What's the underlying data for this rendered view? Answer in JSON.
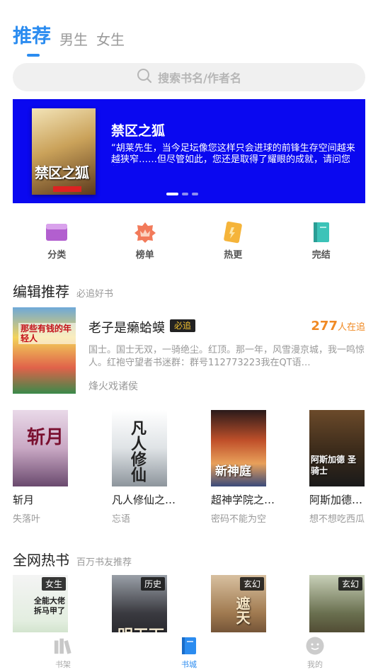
{
  "top_tabs": [
    {
      "label": "推荐",
      "active": true
    },
    {
      "label": "男生",
      "active": false
    },
    {
      "label": "女生",
      "active": false
    }
  ],
  "search": {
    "placeholder": "搜索书名/作者名",
    "icon": "search-icon"
  },
  "banner": {
    "background": "#0a08f0",
    "title": "禁区之狐",
    "description": "“胡莱先生，当今足坛像您这样只会进球的前锋生存空间越来越狭窄……但尽管如此，您还是取得了耀眼的成就，请问您的…",
    "cover_text": "禁区之狐",
    "slide_count": 3,
    "active_slide": 0
  },
  "categories": [
    {
      "label": "分类",
      "icon": "category-icon",
      "color": "#b25fcf"
    },
    {
      "label": "榜单",
      "icon": "ranking-icon",
      "color": "#f27a5a"
    },
    {
      "label": "热更",
      "icon": "hot-update-icon",
      "color": "#f5b43a"
    },
    {
      "label": "完结",
      "icon": "finished-icon",
      "color": "#3cc3b8"
    }
  ],
  "editor_section": {
    "title": "编辑推荐",
    "subtitle": "必追好书"
  },
  "featured_book": {
    "title": "老子是癞蛤蟆",
    "badge": "必追",
    "count": "277",
    "count_unit": "人在追",
    "description": "国士。国士无双，一骑绝尘。红顶。那一年，风雪漫京城，我一鸣惊人。红袍守望者书迷群：群号112773223我在QT语…",
    "author": "烽火戏诸侯",
    "cover_text": "那些有钱的年轻人"
  },
  "editor_books": [
    {
      "name": "斩月",
      "author": "失落叶",
      "cover_text": "斩月"
    },
    {
      "name": "凡人修仙之…",
      "author": "忘语",
      "cover_text": "凡人修仙"
    },
    {
      "name": "超神学院之…",
      "author": "密码不能为空",
      "cover_text": "新神庭"
    },
    {
      "name": "阿斯加德…",
      "author": "想不想吃西瓜",
      "cover_text": "阿斯加德 圣骑士"
    }
  ],
  "hot_section": {
    "title": "全网热书",
    "subtitle": "百万书友推荐"
  },
  "hot_books": [
    {
      "genre": "女生",
      "cover_text": "全能大佬 拆马甲了"
    },
    {
      "genre": "历史",
      "cover_text": "明天下"
    },
    {
      "genre": "玄幻",
      "cover_text": "遮天"
    },
    {
      "genre": "玄幻",
      "cover_text": ""
    }
  ],
  "bottom_nav": [
    {
      "label": "书架",
      "icon": "bookshelf-icon",
      "active": false
    },
    {
      "label": "书城",
      "icon": "bookstore-icon",
      "active": true
    },
    {
      "label": "我的",
      "icon": "profile-icon",
      "active": false
    }
  ],
  "colors": {
    "accent": "#2b8cf0",
    "count": "#f08a24",
    "badge_text": "#f2c230"
  }
}
